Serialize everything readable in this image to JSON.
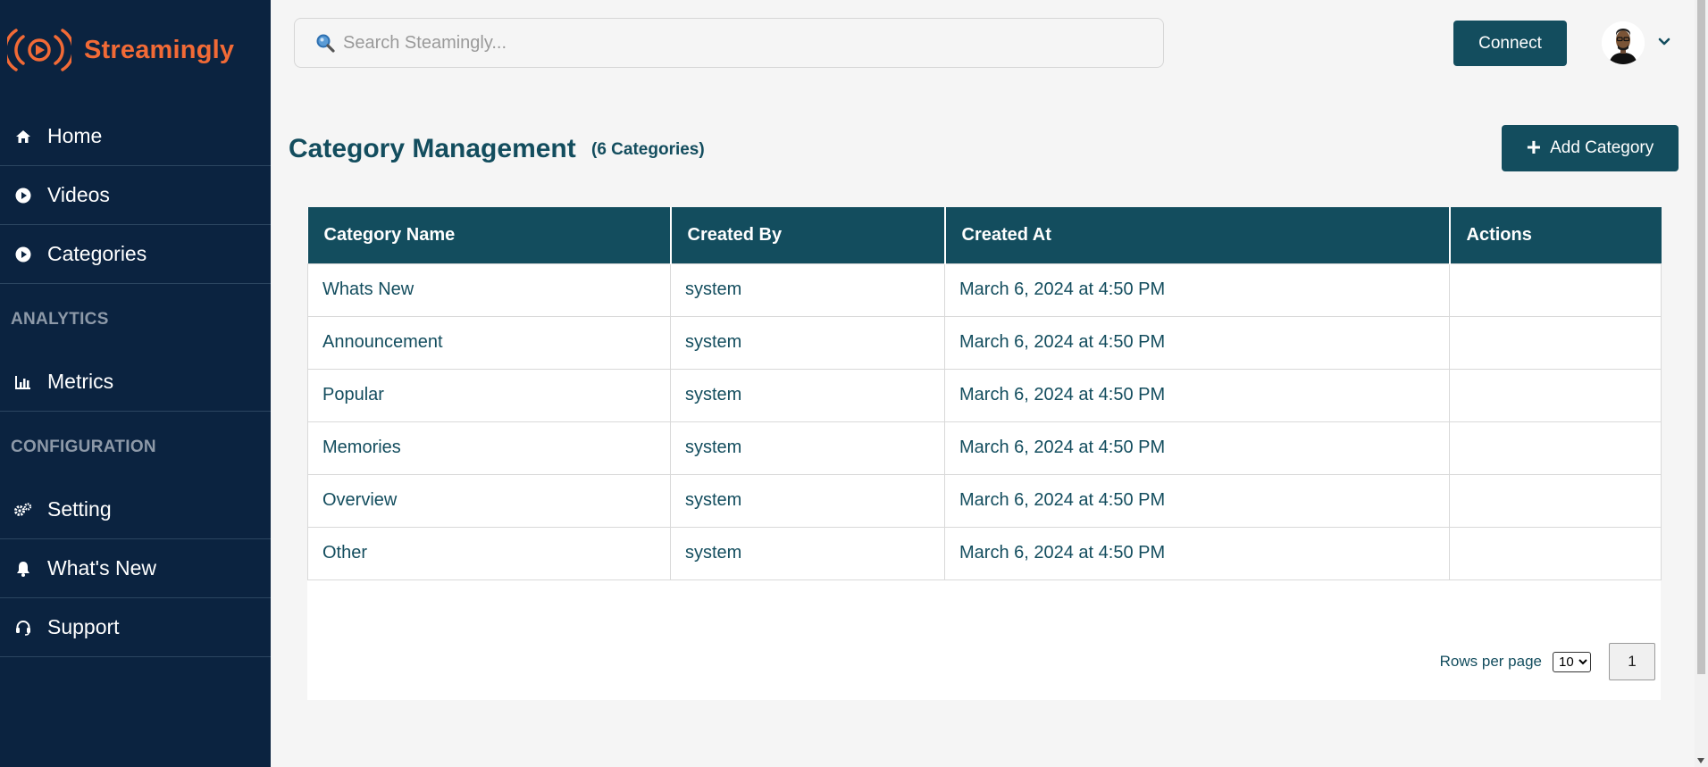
{
  "brand": {
    "name": "Streamingly",
    "color": "#f26a36"
  },
  "sidebar": {
    "items": [
      {
        "label": "Home",
        "icon": "home-icon"
      },
      {
        "label": "Videos",
        "icon": "play-circle-icon"
      },
      {
        "label": "Categories",
        "icon": "play-circle-icon"
      }
    ],
    "analytics_label": "ANALYTICS",
    "analytics_items": [
      {
        "label": "Metrics",
        "icon": "bar-chart-icon"
      }
    ],
    "configuration_label": "CONFIGURATION",
    "configuration_items": [
      {
        "label": "Setting",
        "icon": "gears-icon"
      },
      {
        "label": "What's New",
        "icon": "bell-icon"
      },
      {
        "label": "Support",
        "icon": "headset-icon"
      }
    ]
  },
  "topbar": {
    "search_placeholder": "Search Steamingly...",
    "connect_label": "Connect",
    "avatar_icon": "user-avatar",
    "dropdown_icon": "chevron-down-icon"
  },
  "page": {
    "title": "Category Management",
    "count": "(6 Categories)",
    "add_button": "Add Category"
  },
  "table": {
    "headers": [
      "Category Name",
      "Created By",
      "Created At",
      "Actions"
    ],
    "rows": [
      [
        "Whats New",
        "system",
        "March 6, 2024 at 4:50 PM",
        ""
      ],
      [
        "Announcement",
        "system",
        "March 6, 2024 at 4:50 PM",
        ""
      ],
      [
        "Popular",
        "system",
        "March 6, 2024 at 4:50 PM",
        ""
      ],
      [
        "Memories",
        "system",
        "March 6, 2024 at 4:50 PM",
        ""
      ],
      [
        "Overview",
        "system",
        "March 6, 2024 at 4:50 PM",
        ""
      ],
      [
        "Other",
        "system",
        "March 6, 2024 at 4:50 PM",
        ""
      ]
    ]
  },
  "pagination": {
    "rows_per_page_label": "Rows per page",
    "rows_per_page_value": "10",
    "rows_per_page_options": [
      "10"
    ],
    "current_page": "1"
  },
  "colors": {
    "sidebar_bg": "#0b2340",
    "primary": "#134d5e",
    "accent": "#f26a36"
  }
}
